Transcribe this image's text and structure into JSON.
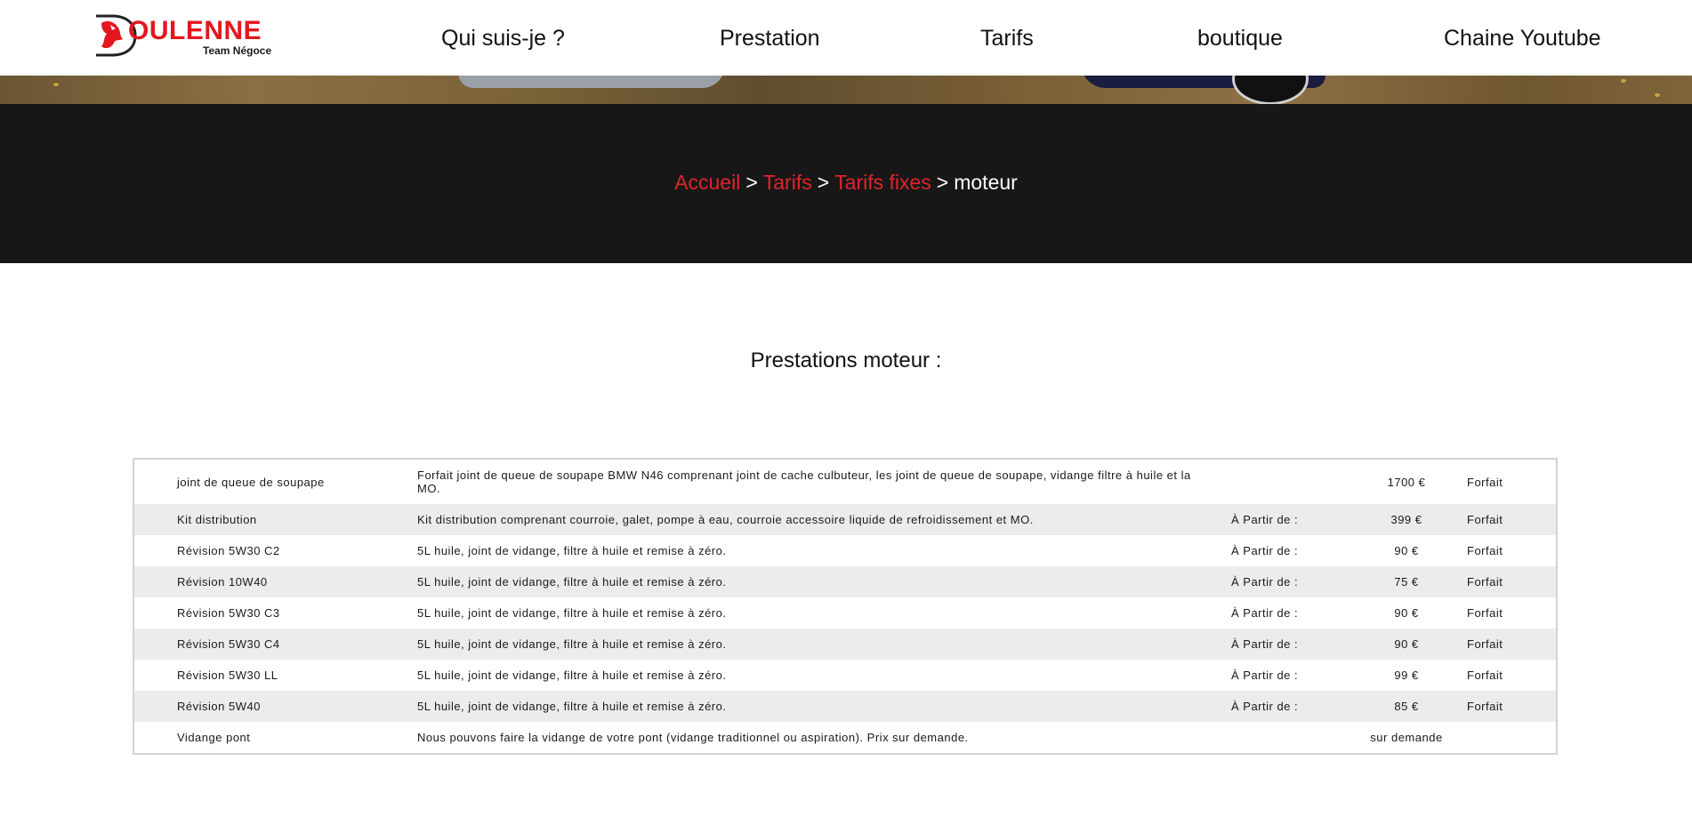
{
  "logo": {
    "main": "OULENNE",
    "sub": "Team Négoce",
    "brand_color": "#e4161d"
  },
  "nav": [
    {
      "label": "Qui suis-je ?"
    },
    {
      "label": "Prestation"
    },
    {
      "label": "Tarifs"
    },
    {
      "label": "boutique"
    },
    {
      "label": "Chaine Youtube"
    }
  ],
  "breadcrumb": {
    "items": [
      "Accueil",
      "Tarifs",
      "Tarifs fixes"
    ],
    "separator": ">",
    "current": "moteur",
    "link_color": "#e0242b"
  },
  "section": {
    "title": "Prestations moteur :"
  },
  "table": {
    "rows": [
      {
        "name": "joint de queue de soupape",
        "description": "Forfait joint de queue de soupape BMW N46 comprenant joint de cache culbuteur, les joint de queue de soupape, vidange filtre à huile et la MO.",
        "from": "",
        "price": "1700 €",
        "unit": "Forfait"
      },
      {
        "name": "Kit distribution",
        "description": "Kit distribution comprenant courroie, galet, pompe à eau, courroie accessoire liquide de refroidissement et MO.",
        "from": "À Partir de :",
        "price": "399 €",
        "unit": "Forfait"
      },
      {
        "name": "Révision 5W30 C2",
        "description": "5L huile, joint de vidange, filtre à huile et remise à zéro.",
        "from": "À Partir de :",
        "price": "90 €",
        "unit": "Forfait"
      },
      {
        "name": "Révision 10W40",
        "description": "5L huile, joint de vidange, filtre à huile et remise à zéro.",
        "from": "À Partir de :",
        "price": "75 €",
        "unit": "Forfait"
      },
      {
        "name": "Révision 5W30 C3",
        "description": "5L huile, joint de vidange, filtre à huile et remise à zéro.",
        "from": "À Partir de :",
        "price": "90 €",
        "unit": "Forfait"
      },
      {
        "name": "Révision 5W30 C4",
        "description": "5L huile, joint de vidange, filtre à huile et remise à zéro.",
        "from": "À Partir de :",
        "price": "90 €",
        "unit": "Forfait"
      },
      {
        "name": "Révision 5W30 LL",
        "description": "5L huile, joint de vidange, filtre à huile et remise à zéro.",
        "from": "À Partir de :",
        "price": "99 €",
        "unit": "Forfait"
      },
      {
        "name": "Révision 5W40",
        "description": "5L huile, joint de vidange, filtre à huile et remise à zéro.",
        "from": "À Partir de :",
        "price": "85 €",
        "unit": "Forfait"
      },
      {
        "name": "Vidange pont",
        "description": "Nous pouvons faire la vidange de votre pont (vidange traditionnel ou aspiration). Prix sur demande.",
        "from": "",
        "price": "sur demande",
        "unit": ""
      }
    ]
  }
}
